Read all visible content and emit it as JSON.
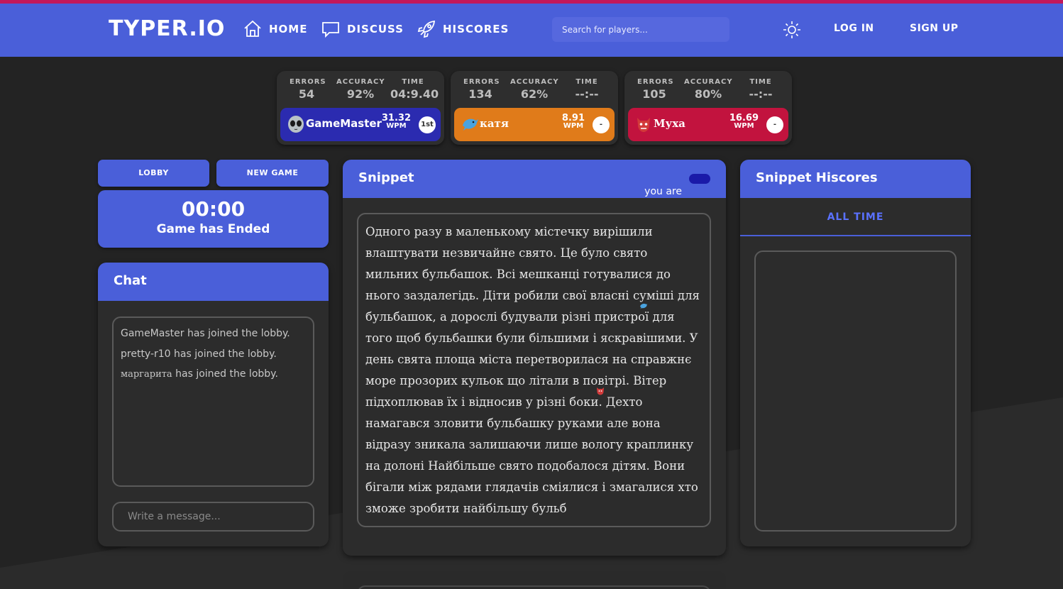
{
  "brand": {
    "logo": "TYPER.IO"
  },
  "nav": [
    {
      "label": "HOME",
      "icon": "home-icon"
    },
    {
      "label": "DISCUSS",
      "icon": "chat-bubble-icon"
    },
    {
      "label": "HISCORES",
      "icon": "rocket-icon"
    }
  ],
  "search": {
    "placeholder": "Search for players..."
  },
  "header": {
    "theme_icon": "sun-icon",
    "login": "LOG IN",
    "signup": "SIGN UP"
  },
  "players": [
    {
      "errors_label": "ERRORS",
      "errors": "54",
      "accuracy_label": "ACCURACY",
      "accuracy": "92%",
      "time_label": "TIME",
      "time": "04:9.40",
      "name": "GameMaster",
      "avatar": "alien-icon",
      "wpm": "31.32",
      "wpm_unit": "WPM",
      "place": "1st",
      "color": "#2b2bb0"
    },
    {
      "errors_label": "ERRORS",
      "errors": "134",
      "accuracy_label": "ACCURACY",
      "accuracy": "62%",
      "time_label": "TIME",
      "time": "--:--",
      "name": "катя",
      "avatar": "dolphin-icon",
      "wpm": "8.91",
      "wpm_unit": "WPM",
      "place": "-",
      "color": "#e07b1a"
    },
    {
      "errors_label": "ERRORS",
      "errors": "105",
      "accuracy_label": "ACCURACY",
      "accuracy": "80%",
      "time_label": "TIME",
      "time": "--:--",
      "name": "Муха",
      "avatar": "ogre-icon",
      "wpm": "16.69",
      "wpm_unit": "WPM",
      "place": "-",
      "color": "#c2133e"
    }
  ],
  "controls": {
    "lobby": "LOBBY",
    "new_game": "NEW GAME"
  },
  "timer": {
    "time": "00:00",
    "status": "Game has Ended"
  },
  "chat": {
    "title": "Chat",
    "messages": [
      {
        "name": "GameMaster",
        "text": " has joined the lobby."
      },
      {
        "name": "pretty-r10",
        "text": " has joined the lobby."
      },
      {
        "name": "маргарита",
        "text": " has joined the lobby."
      }
    ],
    "input_placeholder": "Write a message..."
  },
  "snippet": {
    "title": "Snippet",
    "you_are": "you are",
    "you_color": "#1a1aa8",
    "text": "Одного разу в маленькому містечку вирішили влаштувати незвичайне свято. Це було свято мильних бульбашок. Всі мешканці готувалися до нього заздалегідь. Діти робили свої власні суміші для бульбашок, а дорослі будували різні пристрої для того щоб бульбашки були більшими і яскравішими. У день свята площа міста перетворилася на справжнє море прозорих кульок що літали в повітрі. Вітер підхоплював їх і відносив у різні боки. Дехто намагався зловити бульбашку руками але вона відразу зникала залишаючи лише вологу краплинку на долоні Найбільше свято подобалося дітям. Вони бігали між рядами глядачів сміялися і змагалися хто зможе зробити найбільшу бульб"
  },
  "hiscores": {
    "title": "Snippet Hiscores",
    "tab": "ALL TIME"
  }
}
